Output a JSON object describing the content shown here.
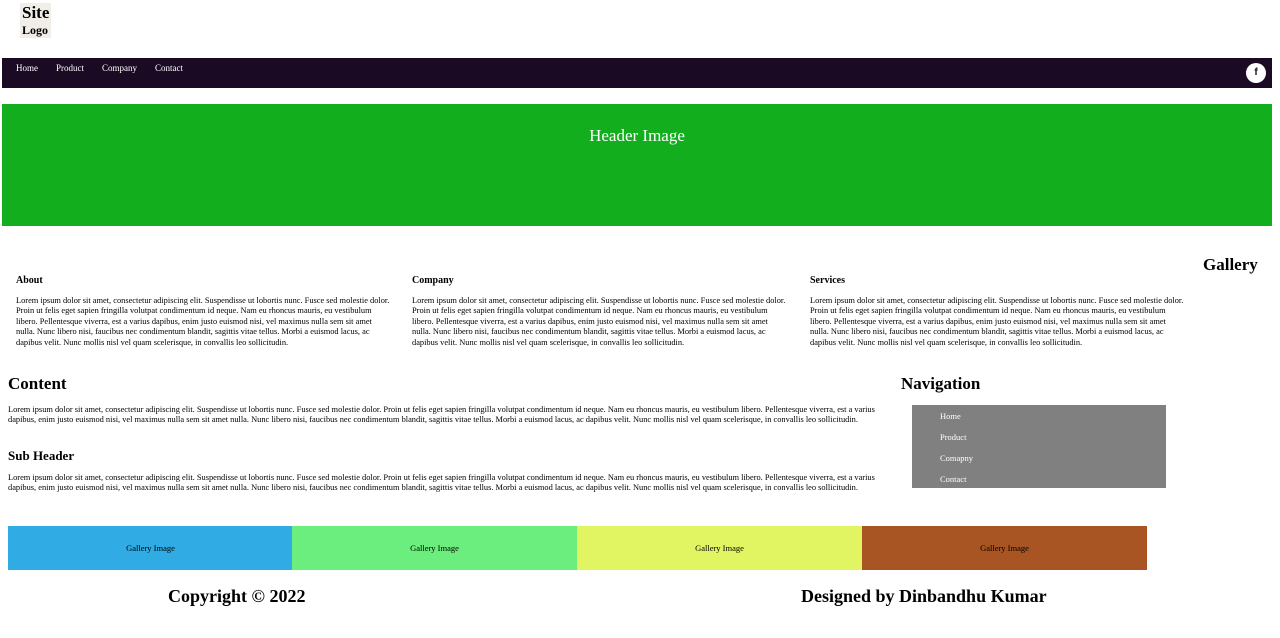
{
  "logo": {
    "line1": "Site",
    "line2": "Logo"
  },
  "topnav": {
    "items": [
      "Home",
      "Product",
      "Company",
      "Contact"
    ],
    "social_icon": "facebook-icon",
    "social_glyph": "f",
    "background": "#1a0a24"
  },
  "hero": {
    "label": "Header Image",
    "background": "#13ae1e"
  },
  "columns": [
    {
      "title": "About",
      "text": "Lorem ipsum dolor sit amet, consectetur adipiscing elit. Suspendisse ut lobortis nunc. Fusce sed molestie dolor. Proin ut felis eget sapien fringilla volutpat condimentum id neque. Nam eu rhoncus mauris, eu vestibulum libero. Pellentesque viverra, est a varius dapibus, enim justo euismod nisi, vel maximus nulla sem sit amet nulla. Nunc libero nisi, faucibus nec condimentum blandit, sagittis vitae tellus. Morbi a euismod lacus, ac dapibus velit. Nunc mollis nisl vel quam scelerisque, in convallis leo sollicitudin."
    },
    {
      "title": "Company",
      "text": "Lorem ipsum dolor sit amet, consectetur adipiscing elit. Suspendisse ut lobortis nunc. Fusce sed molestie dolor. Proin ut felis eget sapien fringilla volutpat condimentum id neque. Nam eu rhoncus mauris, eu vestibulum libero. Pellentesque viverra, est a varius dapibus, enim justo euismod nisi, vel maximus nulla sem sit amet nulla. Nunc libero nisi, faucibus nec condimentum blandit, sagittis vitae tellus. Morbi a euismod lacus, ac dapibus velit. Nunc mollis nisl vel quam scelerisque, in convallis leo sollicitudin."
    },
    {
      "title": "Services",
      "text": "Lorem ipsum dolor sit amet, consectetur adipiscing elit. Suspendisse ut lobortis nunc. Fusce sed molestie dolor. Proin ut felis eget sapien fringilla volutpat condimentum id neque. Nam eu rhoncus mauris, eu vestibulum libero. Pellentesque viverra, est a varius dapibus, enim justo euismod nisi, vel maximus nulla sem sit amet nulla. Nunc libero nisi, faucibus nec condimentum blandit, sagittis vitae tellus. Morbi a euismod lacus, ac dapibus velit. Nunc mollis nisl vel quam scelerisque, in convallis leo sollicitudin."
    }
  ],
  "gallery_title": "Gallery",
  "content": {
    "title": "Content",
    "text1": "Lorem ipsum dolor sit amet, consectetur adipiscing elit. Suspendisse ut lobortis nunc. Fusce sed molestie dolor. Proin ut felis eget sapien fringilla volutpat condimentum id neque. Nam eu rhoncus mauris, eu vestibulum libero. Pellentesque viverra, est a varius dapibus, enim justo euismod nisi, vel maximus nulla sem sit amet nulla. Nunc libero nisi, faucibus nec condimentum blandit, sagittis vitae tellus. Morbi a euismod lacus, ac dapibus velit. Nunc mollis nisl vel quam scelerisque, in convallis leo sollicitudin.",
    "subheader": "Sub Header",
    "text2": "Lorem ipsum dolor sit amet, consectetur adipiscing elit. Suspendisse ut lobortis nunc. Fusce sed molestie dolor. Proin ut felis eget sapien fringilla volutpat condimentum id neque. Nam eu rhoncus mauris, eu vestibulum libero. Pellentesque viverra, est a varius dapibus, enim justo euismod nisi, vel maximus nulla sem sit amet nulla. Nunc libero nisi, faucibus nec condimentum blandit, sagittis vitae tellus. Morbi a euismod lacus, ac dapibus velit. Nunc mollis nisl vel quam scelerisque, in convallis leo sollicitudin."
  },
  "sidenav": {
    "title": "Navigation",
    "items": [
      "Home",
      "Product",
      "Comapny",
      "Contact"
    ]
  },
  "gallery": [
    {
      "label": "Gallery Image",
      "color": "#30abe3"
    },
    {
      "label": "Gallery Image",
      "color": "#6bee7d"
    },
    {
      "label": "Gallery Image",
      "color": "#e1f562"
    },
    {
      "label": "Gallery Image",
      "color": "#a85523"
    }
  ],
  "footer": {
    "copyright": "Copyright © 2022",
    "designer": "Designed by Dinbandhu Kumar"
  }
}
